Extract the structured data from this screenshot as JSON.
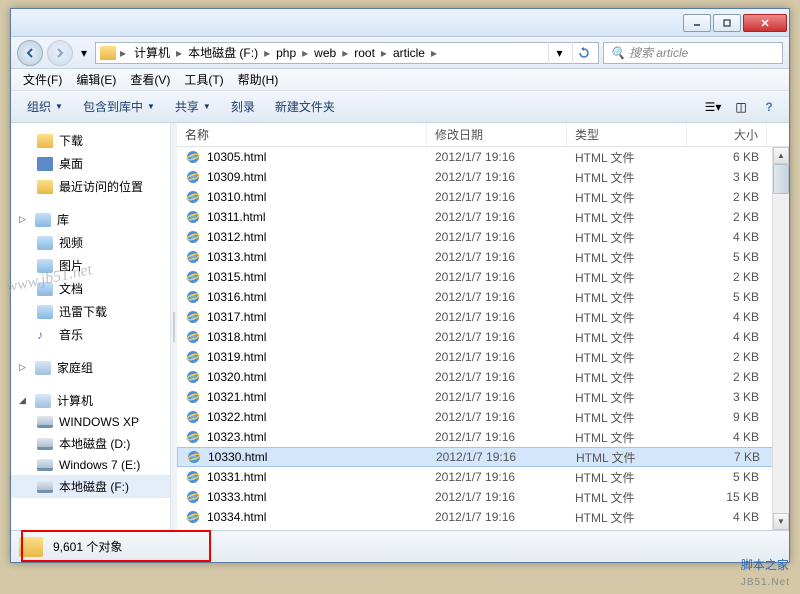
{
  "titlebar": {},
  "breadcrumb": {
    "items": [
      "计算机",
      "本地磁盘 (F:)",
      "php",
      "web",
      "root",
      "article"
    ]
  },
  "search": {
    "placeholder": "搜索 article"
  },
  "menu": {
    "file": "文件(F)",
    "edit": "编辑(E)",
    "view": "查看(V)",
    "tools": "工具(T)",
    "help": "帮助(H)"
  },
  "toolbar": {
    "organize": "组织",
    "include": "包含到库中",
    "share": "共享",
    "burn": "刻录",
    "newfolder": "新建文件夹"
  },
  "sidebar": {
    "downloads": "下载",
    "desktop": "桌面",
    "recent": "最近访问的位置",
    "lib": "库",
    "video": "视频",
    "pictures": "图片",
    "documents": "文档",
    "xunlei": "迅雷下载",
    "music": "音乐",
    "homegroup": "家庭组",
    "computer": "计算机",
    "drive_c": "WINDOWS XP",
    "drive_d": "本地磁盘 (D:)",
    "drive_e": "Windows 7 (E:)",
    "drive_f": "本地磁盘 (F:)"
  },
  "columns": {
    "name": "名称",
    "date": "修改日期",
    "type": "类型",
    "size": "大小"
  },
  "files": [
    {
      "name": "10305.html",
      "date": "2012/1/7 19:16",
      "type": "HTML 文件",
      "size": "6 KB",
      "sel": false
    },
    {
      "name": "10309.html",
      "date": "2012/1/7 19:16",
      "type": "HTML 文件",
      "size": "3 KB",
      "sel": false
    },
    {
      "name": "10310.html",
      "date": "2012/1/7 19:16",
      "type": "HTML 文件",
      "size": "2 KB",
      "sel": false
    },
    {
      "name": "10311.html",
      "date": "2012/1/7 19:16",
      "type": "HTML 文件",
      "size": "2 KB",
      "sel": false
    },
    {
      "name": "10312.html",
      "date": "2012/1/7 19:16",
      "type": "HTML 文件",
      "size": "4 KB",
      "sel": false
    },
    {
      "name": "10313.html",
      "date": "2012/1/7 19:16",
      "type": "HTML 文件",
      "size": "5 KB",
      "sel": false
    },
    {
      "name": "10315.html",
      "date": "2012/1/7 19:16",
      "type": "HTML 文件",
      "size": "2 KB",
      "sel": false
    },
    {
      "name": "10316.html",
      "date": "2012/1/7 19:16",
      "type": "HTML 文件",
      "size": "5 KB",
      "sel": false
    },
    {
      "name": "10317.html",
      "date": "2012/1/7 19:16",
      "type": "HTML 文件",
      "size": "4 KB",
      "sel": false
    },
    {
      "name": "10318.html",
      "date": "2012/1/7 19:16",
      "type": "HTML 文件",
      "size": "4 KB",
      "sel": false
    },
    {
      "name": "10319.html",
      "date": "2012/1/7 19:16",
      "type": "HTML 文件",
      "size": "2 KB",
      "sel": false
    },
    {
      "name": "10320.html",
      "date": "2012/1/7 19:16",
      "type": "HTML 文件",
      "size": "2 KB",
      "sel": false
    },
    {
      "name": "10321.html",
      "date": "2012/1/7 19:16",
      "type": "HTML 文件",
      "size": "3 KB",
      "sel": false
    },
    {
      "name": "10322.html",
      "date": "2012/1/7 19:16",
      "type": "HTML 文件",
      "size": "9 KB",
      "sel": false
    },
    {
      "name": "10323.html",
      "date": "2012/1/7 19:16",
      "type": "HTML 文件",
      "size": "4 KB",
      "sel": false
    },
    {
      "name": "10330.html",
      "date": "2012/1/7 19:16",
      "type": "HTML 文件",
      "size": "7 KB",
      "sel": true
    },
    {
      "name": "10331.html",
      "date": "2012/1/7 19:16",
      "type": "HTML 文件",
      "size": "5 KB",
      "sel": false
    },
    {
      "name": "10333.html",
      "date": "2012/1/7 19:16",
      "type": "HTML 文件",
      "size": "15 KB",
      "sel": false
    },
    {
      "name": "10334.html",
      "date": "2012/1/7 19:16",
      "type": "HTML 文件",
      "size": "4 KB",
      "sel": false
    }
  ],
  "status": {
    "count": "9,601 个对象"
  },
  "branding": {
    "main": "脚本之家",
    "sub": "JB51.Net"
  },
  "watermark": "www.jb51.net"
}
